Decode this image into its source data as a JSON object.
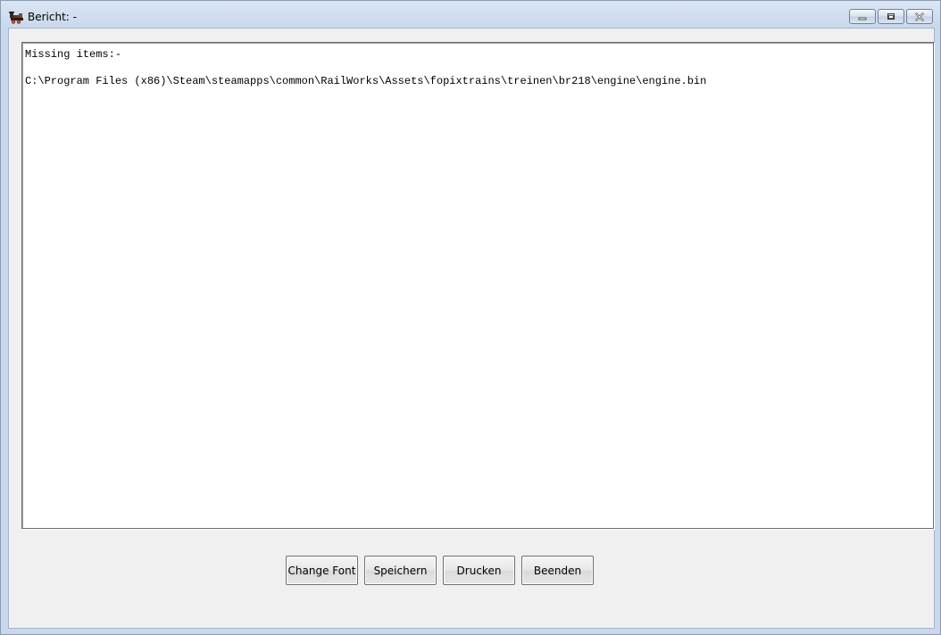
{
  "window": {
    "title": "Bericht: -",
    "icon": "steam-locomotive-icon",
    "controls": [
      "minimize-icon",
      "restore-icon",
      "close-icon"
    ]
  },
  "report": {
    "lines": [
      "Missing items:-",
      "",
      "C:\\Program Files (x86)\\Steam\\steamapps\\common\\RailWorks\\Assets\\fopixtrains\\treinen\\br218\\engine\\engine.bin"
    ]
  },
  "buttons": {
    "change_font": "Change Font",
    "save": "Speichern",
    "print": "Drucken",
    "exit": "Beenden"
  },
  "colors": {
    "titlebar": "#c9d8ec",
    "client_bg": "#f0f0f0",
    "close_x": "#b03a2e"
  }
}
